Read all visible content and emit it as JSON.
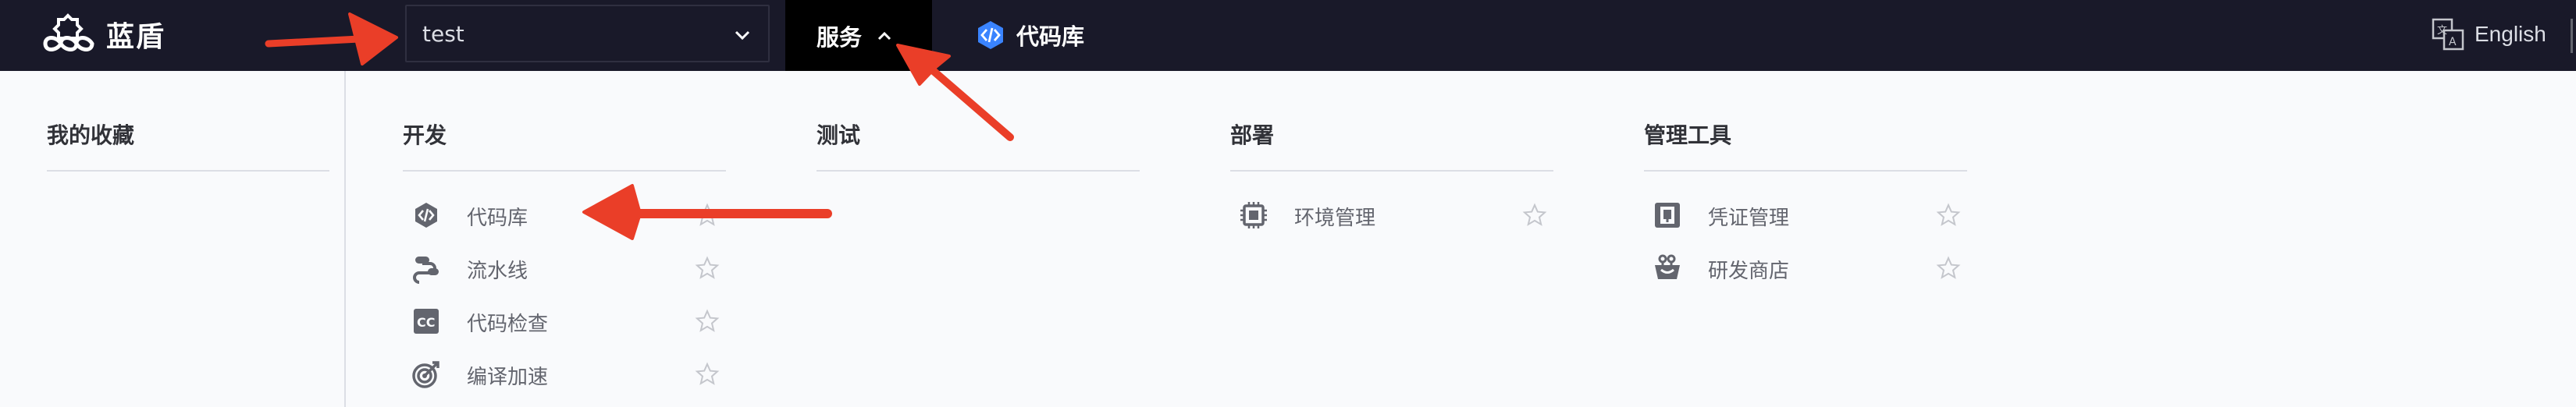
{
  "topbar": {
    "brand": "蓝盾",
    "project_select": {
      "value": "test"
    },
    "service_tab": {
      "label": "服务"
    },
    "code_repo_link": {
      "label": "代码库"
    },
    "language": {
      "label": "English"
    }
  },
  "menu": {
    "favorites": {
      "title": "我的收藏"
    },
    "columns": [
      {
        "title": "开发",
        "items": [
          {
            "label": "代码库",
            "icon": "code-repo-icon"
          },
          {
            "label": "流水线",
            "icon": "pipeline-icon"
          },
          {
            "label": "代码检查",
            "icon": "code-check-icon"
          },
          {
            "label": "编译加速",
            "icon": "compile-accel-icon"
          }
        ]
      },
      {
        "title": "测试",
        "items": []
      },
      {
        "title": "部署",
        "items": [
          {
            "label": "环境管理",
            "icon": "environment-icon"
          }
        ]
      },
      {
        "title": "管理工具",
        "items": [
          {
            "label": "凭证管理",
            "icon": "credential-icon"
          },
          {
            "label": "研发商店",
            "icon": "store-icon"
          }
        ]
      }
    ]
  },
  "colors": {
    "topbar_bg": "#191929",
    "active_tab_bg": "#000000",
    "accent_blue": "#3a84ff",
    "annotation_red": "#ea3e28",
    "panel_bg": "#f9fafc"
  }
}
